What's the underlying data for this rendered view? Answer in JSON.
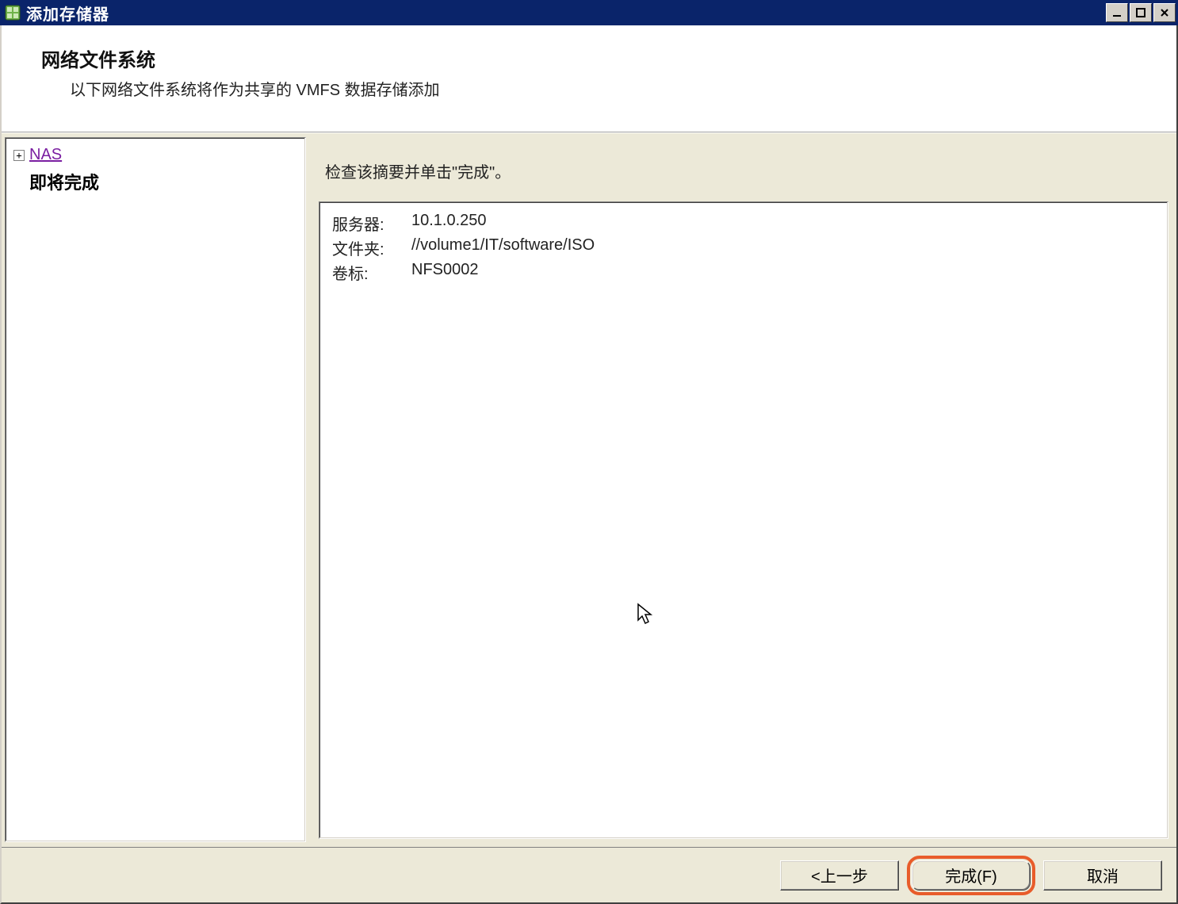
{
  "titlebar": {
    "title": "添加存储器"
  },
  "header": {
    "title": "网络文件系统",
    "subtitle": "以下网络文件系统将作为共享的 VMFS 数据存储添加"
  },
  "sidebar": {
    "root_label": "NAS",
    "current_step": "即将完成"
  },
  "main": {
    "instruction": "检查该摘要并单击\"完成\"。",
    "summary": {
      "server_label": "服务器:",
      "server_value": "10.1.0.250",
      "folder_label": "文件夹:",
      "folder_value": "//volume1/IT/software/ISO",
      "label_label": "卷标:",
      "label_value": "NFS0002"
    }
  },
  "footer": {
    "back": "<上一步",
    "finish": "完成(F)",
    "cancel": "取消"
  }
}
